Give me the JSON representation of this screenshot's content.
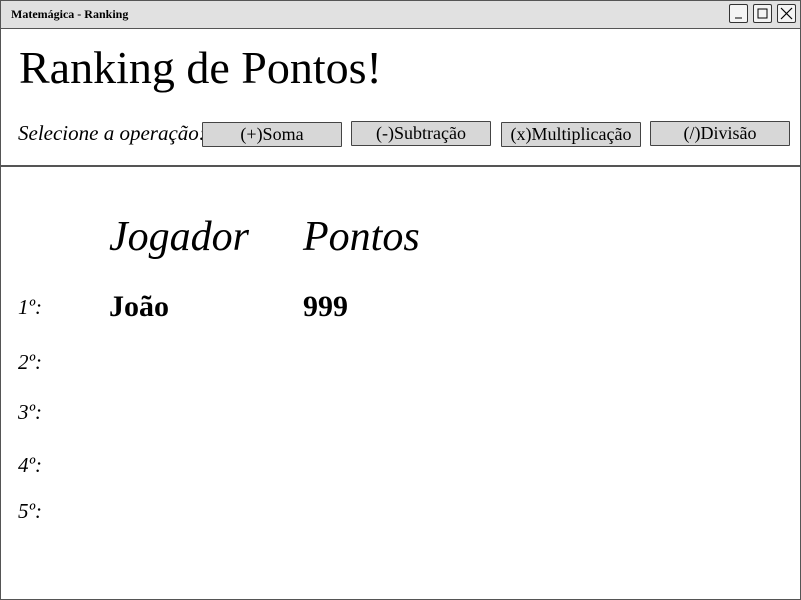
{
  "window": {
    "title": "Matemágica - Ranking"
  },
  "page": {
    "title": "Ranking de Pontos!"
  },
  "operations": {
    "label": "Selecione a operação:",
    "buttons": [
      {
        "label": "(+)Soma"
      },
      {
        "label": "(-)Subtração"
      },
      {
        "label": "(x)Multiplicação"
      },
      {
        "label": "(/)Divisão"
      }
    ]
  },
  "ranking": {
    "headers": {
      "player": "Jogador",
      "points": "Pontos"
    },
    "rows": [
      {
        "rank": "1º:",
        "player": "João",
        "points": "999"
      },
      {
        "rank": "2º:",
        "player": "",
        "points": ""
      },
      {
        "rank": "3º:",
        "player": "",
        "points": ""
      },
      {
        "rank": "4º:",
        "player": "",
        "points": ""
      },
      {
        "rank": "5º:",
        "player": "",
        "points": ""
      }
    ]
  }
}
